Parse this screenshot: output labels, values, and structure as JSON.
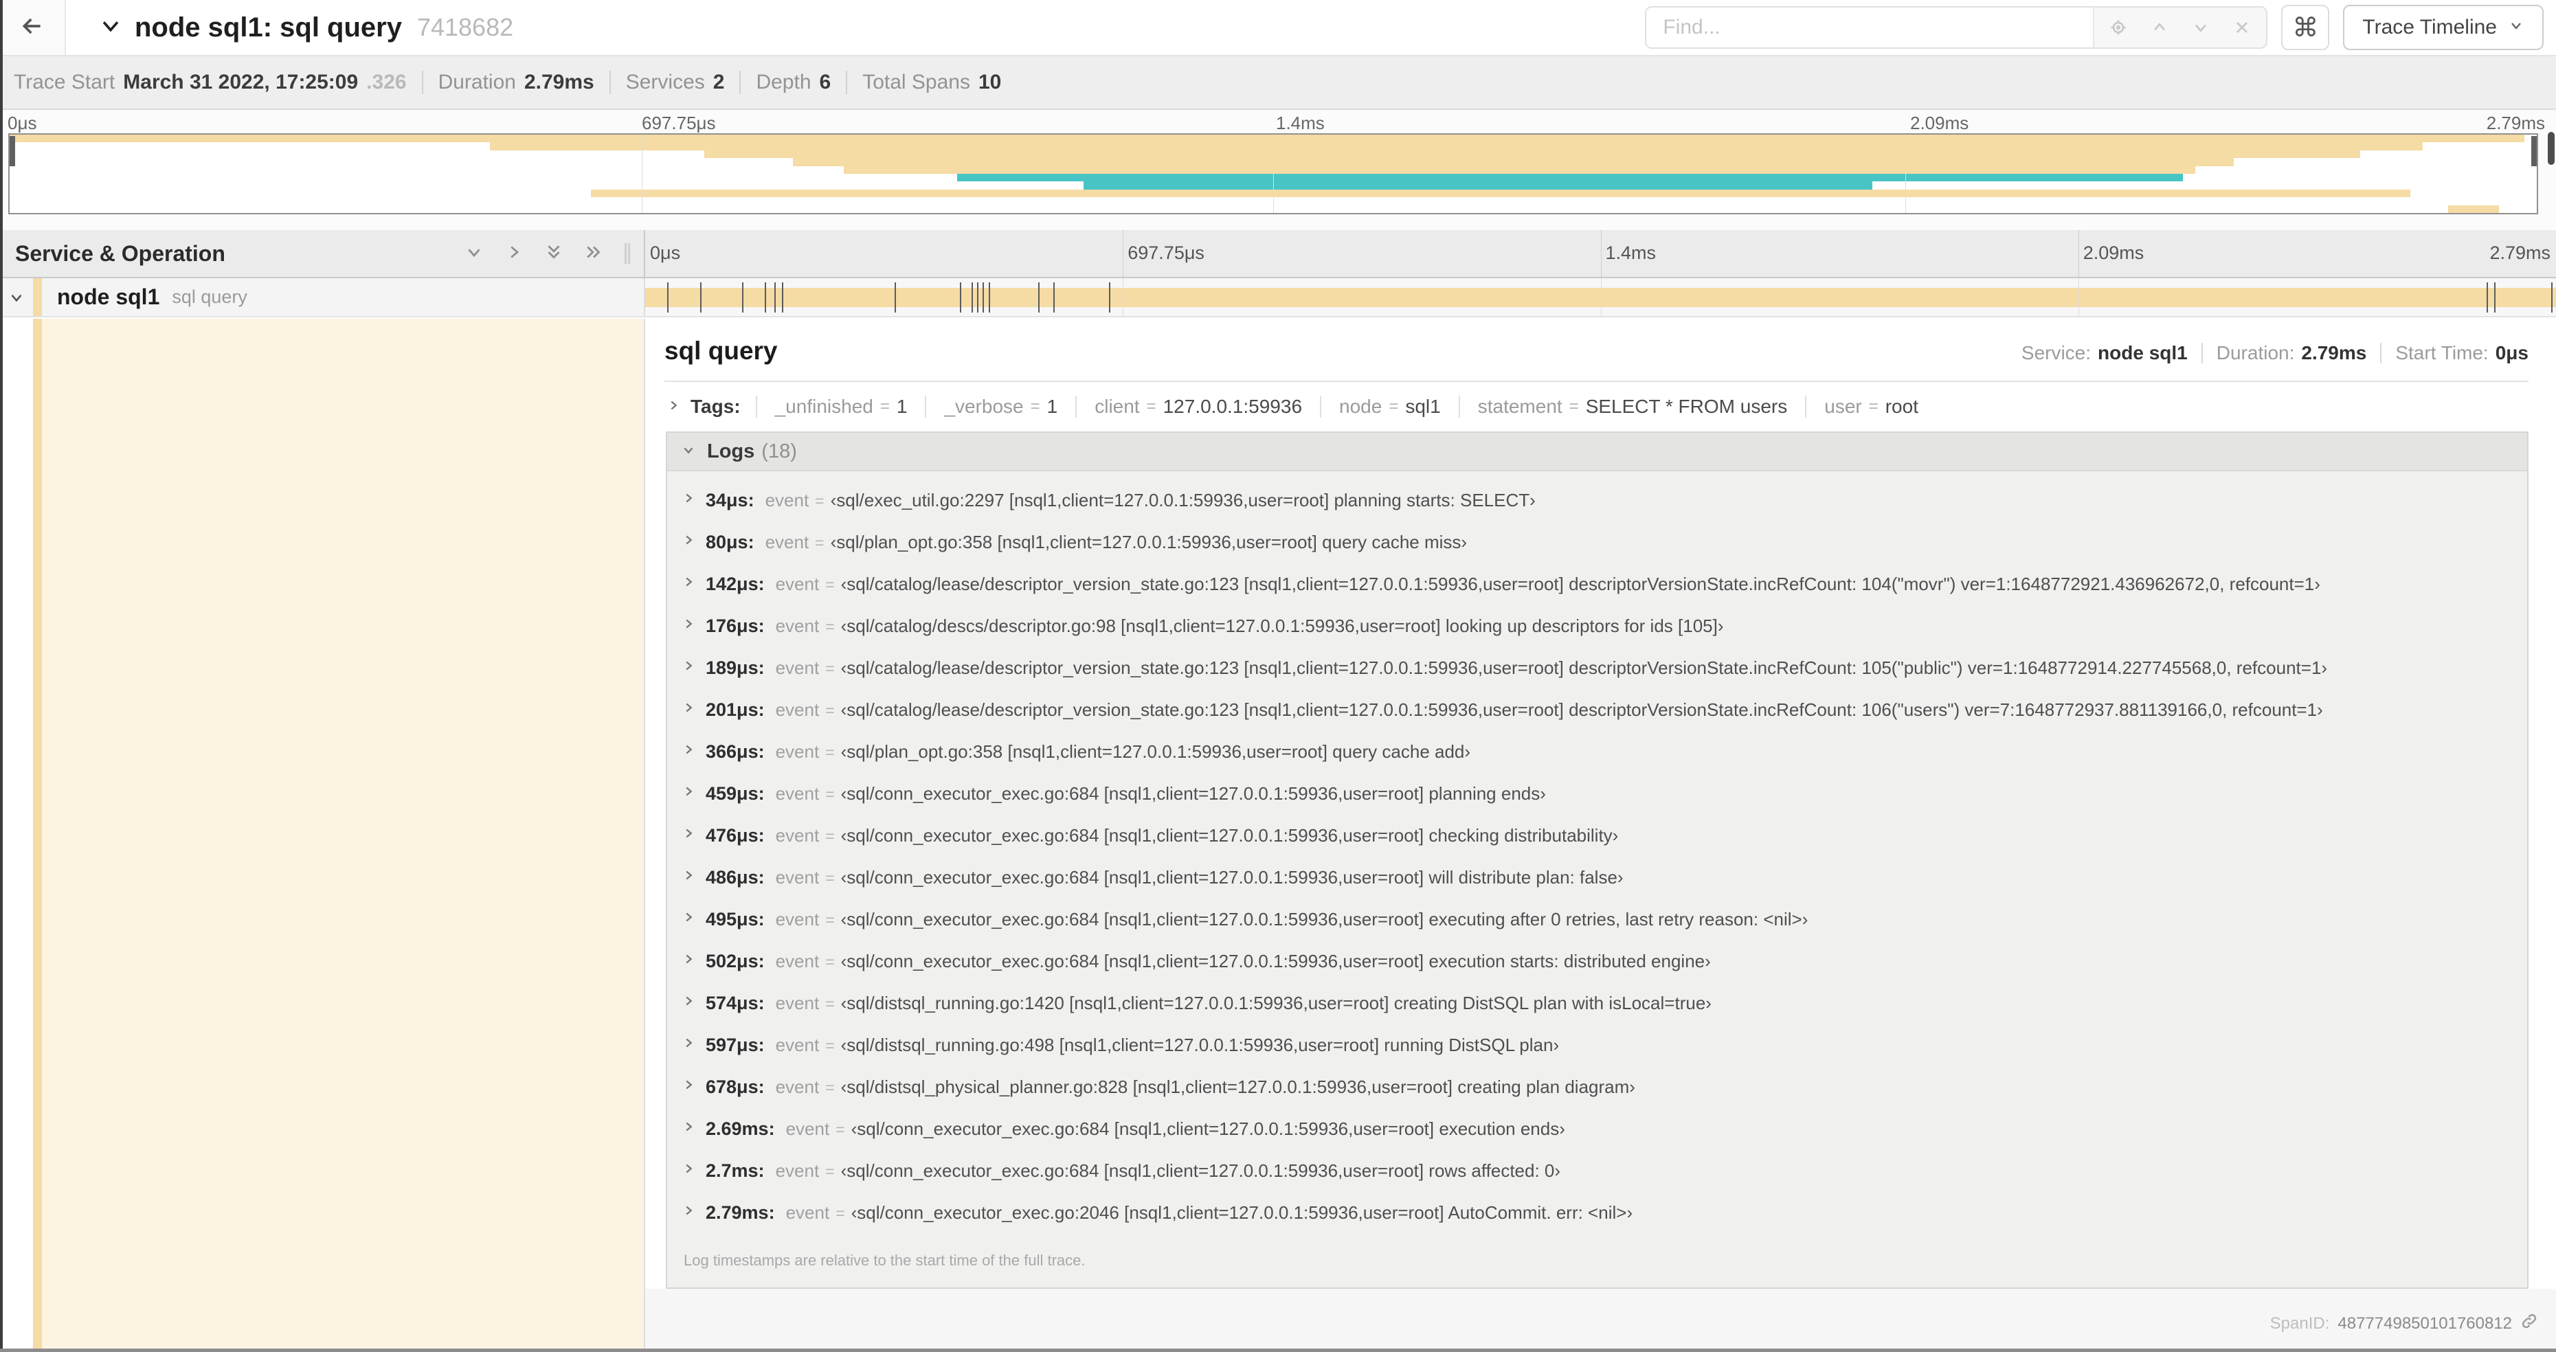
{
  "colors": {
    "tan": "#f5dba4",
    "teal": "#49c4c4",
    "cream": "#fcf4e1"
  },
  "topbar": {
    "title": "node sql1: sql query",
    "trace_id": "7418682",
    "find_placeholder": "Find...",
    "kbd_label": "⌘",
    "view_button_label": "Trace Timeline"
  },
  "meta": {
    "items": [
      {
        "label": "Trace Start",
        "value": "March 31 2022, 17:25:09",
        "suffix": ".326"
      },
      {
        "label": "Duration",
        "value": "2.79ms",
        "suffix": ""
      },
      {
        "label": "Services",
        "value": "2",
        "suffix": ""
      },
      {
        "label": "Depth",
        "value": "6",
        "suffix": ""
      },
      {
        "label": "Total Spans",
        "value": "10",
        "suffix": ""
      }
    ]
  },
  "timeline": {
    "ticks": [
      {
        "label": "0μs",
        "pos": 0
      },
      {
        "label": "697.75μs",
        "pos": 25
      },
      {
        "label": "1.4ms",
        "pos": 50
      },
      {
        "label": "2.09ms",
        "pos": 75
      },
      {
        "label": "2.79ms",
        "pos": 100
      }
    ],
    "gridlines": [
      25,
      50,
      75
    ]
  },
  "minimap": {
    "spans": [
      {
        "start": 0,
        "end": 99.5,
        "color": "tan"
      },
      {
        "start": 19,
        "end": 95.5,
        "color": "tan"
      },
      {
        "start": 27.5,
        "end": 93,
        "color": "tan"
      },
      {
        "start": 31,
        "end": 88,
        "color": "tan"
      },
      {
        "start": 33,
        "end": 86.5,
        "color": "tan"
      },
      {
        "start": 37.5,
        "end": 86,
        "color": "teal"
      },
      {
        "start": 42.5,
        "end": 73.7,
        "color": "teal"
      },
      {
        "start": 23,
        "end": 95,
        "color": "tan"
      },
      {
        "start": 0,
        "end": 0,
        "color": "tan"
      },
      {
        "start": 96.5,
        "end": 98.5,
        "color": "tan"
      }
    ]
  },
  "left_panel": {
    "header": "Service & Operation",
    "row": {
      "service": "node sql1",
      "operation": "sql query"
    }
  },
  "detail": {
    "title": "sql query",
    "overview": [
      {
        "label": "Service:",
        "value": "node sql1"
      },
      {
        "label": "Duration:",
        "value": "2.79ms"
      },
      {
        "label": "Start Time:",
        "value": "0μs"
      }
    ],
    "tags_label": "Tags:",
    "tags": [
      {
        "key": "_unfinished",
        "value": "1"
      },
      {
        "key": "_verbose",
        "value": "1"
      },
      {
        "key": "client",
        "value": "127.0.0.1:59936"
      },
      {
        "key": "node",
        "value": "sql1"
      },
      {
        "key": "statement",
        "value": "SELECT * FROM users"
      },
      {
        "key": "user",
        "value": "root"
      }
    ],
    "logs_label": "Logs",
    "logs_count": "(18)",
    "logs": [
      {
        "time": "34μs:",
        "key": "event",
        "pos": 1.2,
        "value": "sql/exec_util.go:2297 [nsql1,client=127.0.0.1:59936,user=root] planning starts: SELECT"
      },
      {
        "time": "80μs:",
        "key": "event",
        "pos": 2.9,
        "value": "sql/plan_opt.go:358 [nsql1,client=127.0.0.1:59936,user=root] query cache miss"
      },
      {
        "time": "142μs:",
        "key": "event",
        "pos": 5.1,
        "value": "sql/catalog/lease/descriptor_version_state.go:123 [nsql1,client=127.0.0.1:59936,user=root] descriptorVersionState.incRefCount: 104(\"movr\") ver=1:1648772921.436962672,0, refcount=1"
      },
      {
        "time": "176μs:",
        "key": "event",
        "pos": 6.3,
        "value": "sql/catalog/descs/descriptor.go:98 [nsql1,client=127.0.0.1:59936,user=root] looking up descriptors for ids [105]"
      },
      {
        "time": "189μs:",
        "key": "event",
        "pos": 6.8,
        "value": "sql/catalog/lease/descriptor_version_state.go:123 [nsql1,client=127.0.0.1:59936,user=root] descriptorVersionState.incRefCount: 105(\"public\") ver=1:1648772914.227745568,0, refcount=1"
      },
      {
        "time": "201μs:",
        "key": "event",
        "pos": 7.2,
        "value": "sql/catalog/lease/descriptor_version_state.go:123 [nsql1,client=127.0.0.1:59936,user=root] descriptorVersionState.incRefCount: 106(\"users\") ver=7:1648772937.881139166,0, refcount=1"
      },
      {
        "time": "366μs:",
        "key": "event",
        "pos": 13.1,
        "value": "sql/plan_opt.go:358 [nsql1,client=127.0.0.1:59936,user=root] query cache add"
      },
      {
        "time": "459μs:",
        "key": "event",
        "pos": 16.5,
        "value": "sql/conn_executor_exec.go:684 [nsql1,client=127.0.0.1:59936,user=root] planning ends"
      },
      {
        "time": "476μs:",
        "key": "event",
        "pos": 17.1,
        "value": "sql/conn_executor_exec.go:684 [nsql1,client=127.0.0.1:59936,user=root] checking distributability"
      },
      {
        "time": "486μs:",
        "key": "event",
        "pos": 17.4,
        "value": "sql/conn_executor_exec.go:684 [nsql1,client=127.0.0.1:59936,user=root] will distribute plan: false"
      },
      {
        "time": "495μs:",
        "key": "event",
        "pos": 17.7,
        "value": "sql/conn_executor_exec.go:684 [nsql1,client=127.0.0.1:59936,user=root] executing after 0 retries, last retry reason: <nil>"
      },
      {
        "time": "502μs:",
        "key": "event",
        "pos": 18.0,
        "value": "sql/conn_executor_exec.go:684 [nsql1,client=127.0.0.1:59936,user=root] execution starts: distributed engine"
      },
      {
        "time": "574μs:",
        "key": "event",
        "pos": 20.6,
        "value": "sql/distsql_running.go:1420 [nsql1,client=127.0.0.1:59936,user=root] creating DistSQL plan with isLocal=true"
      },
      {
        "time": "597μs:",
        "key": "event",
        "pos": 21.4,
        "value": "sql/distsql_running.go:498 [nsql1,client=127.0.0.1:59936,user=root] running DistSQL plan"
      },
      {
        "time": "678μs:",
        "key": "event",
        "pos": 24.3,
        "value": "sql/distsql_physical_planner.go:828 [nsql1,client=127.0.0.1:59936,user=root] creating plan diagram"
      },
      {
        "time": "2.69ms:",
        "key": "event",
        "pos": 96.4,
        "value": "sql/conn_executor_exec.go:684 [nsql1,client=127.0.0.1:59936,user=root] execution ends"
      },
      {
        "time": "2.7ms:",
        "key": "event",
        "pos": 96.8,
        "value": "sql/conn_executor_exec.go:684 [nsql1,client=127.0.0.1:59936,user=root] rows affected: 0"
      },
      {
        "time": "2.79ms:",
        "key": "event",
        "pos": 99.8,
        "value": "sql/conn_executor_exec.go:2046 [nsql1,client=127.0.0.1:59936,user=root] AutoCommit. err: <nil>"
      }
    ],
    "footer_note": "Log timestamps are relative to the start time of the full trace.",
    "spanid_label": "SpanID:",
    "spanid_value": "4877749850101760812"
  }
}
